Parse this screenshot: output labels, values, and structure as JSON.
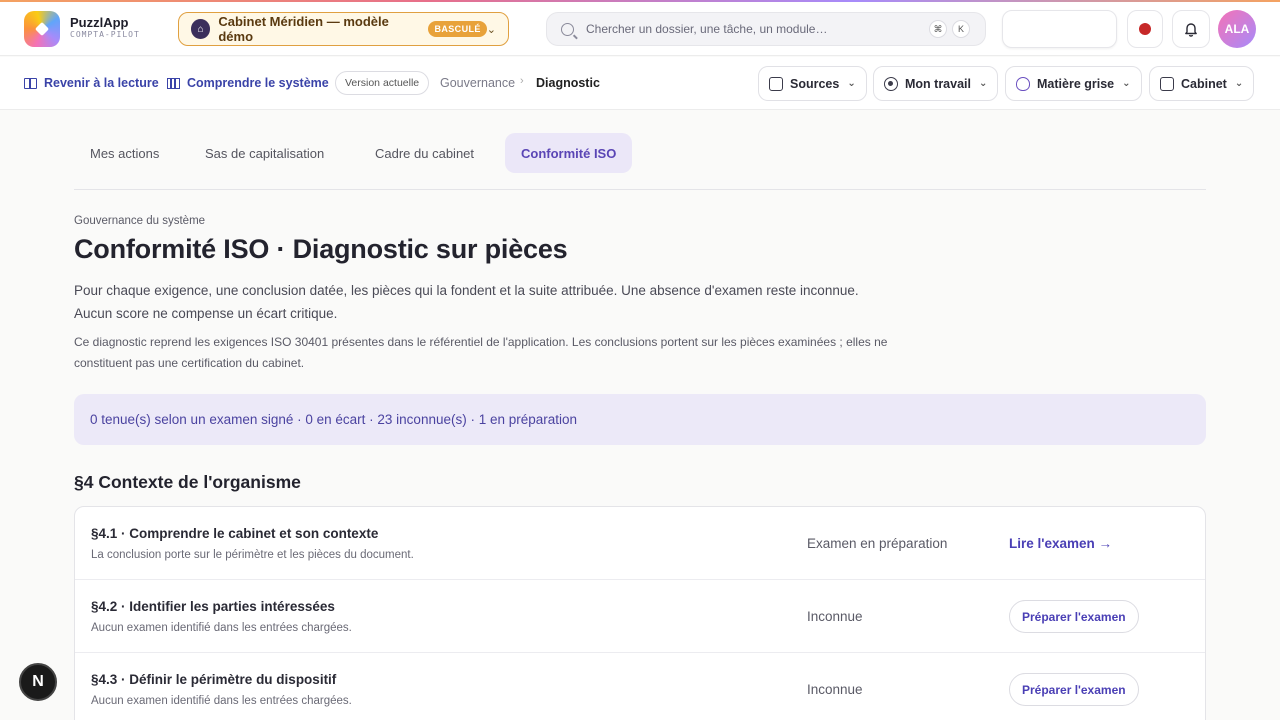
{
  "brand": {
    "name": "PuzzlApp",
    "subtitle": "COMPTA-PILOT"
  },
  "cabinet": {
    "name": "Cabinet Méridien — modèle démo",
    "badge": "BASCULÉ"
  },
  "search": {
    "placeholder": "Chercher un dossier, une tâche, un module…",
    "kbd_modifier": "⌘",
    "kbd_key": "K"
  },
  "user": {
    "initials": "ALA"
  },
  "nav": {
    "back_label": "Revenir à la lecture",
    "understand_label": "Comprendre le système",
    "version_chip": "Version actuelle",
    "breadcrumb": [
      "Gouvernance",
      "Diagnostic"
    ],
    "menus": [
      {
        "label": "Sources",
        "icon": "inbox-icon"
      },
      {
        "label": "Mon travail",
        "icon": "target-icon"
      },
      {
        "label": "Matière grise",
        "icon": "brain-icon"
      },
      {
        "label": "Cabinet",
        "icon": "building-icon"
      }
    ]
  },
  "tabs": [
    {
      "label": "Mes actions",
      "active": false
    },
    {
      "label": "Sas de capitalisation",
      "active": false
    },
    {
      "label": "Cadre du cabinet",
      "active": false
    },
    {
      "label": "Conformité ISO",
      "active": true
    }
  ],
  "page": {
    "eyebrow": "Gouvernance du système",
    "title": "Conformité ISO · Diagnostic sur pièces",
    "lead_line1": "Pour chaque exigence, une conclusion datée, les pièces qui la fondent et la suite attribuée. Une absence d'examen reste inconnue.",
    "lead_line2": "Aucun score ne compense un écart critique.",
    "note": "Ce diagnostic reprend les exigences ISO 30401 présentes dans le référentiel de l'application. Les conclusions portent sur les pièces examinées ; elles ne constituent pas une certification du cabinet.",
    "summary": "0 tenue(s) selon un examen signé · 0 en écart · 23 inconnue(s) · 1 en préparation"
  },
  "section": {
    "title": "§4 Contexte de l'organisme",
    "requirements": [
      {
        "title": "§4.1 · Comprendre le cabinet et son contexte",
        "desc": "La conclusion porte sur le périmètre et les pièces du document.",
        "status": "Examen en préparation",
        "action": "Lire l'examen →",
        "action_type": "link"
      },
      {
        "title": "§4.2 · Identifier les parties intéressées",
        "desc": "Aucun examen identifié dans les entrées chargées.",
        "status": "Inconnue",
        "action": "Préparer l'examen",
        "action_type": "button"
      },
      {
        "title": "§4.3 · Définir le périmètre du dispositif",
        "desc": "Aucun examen identifié dans les entrées chargées.",
        "status": "Inconnue",
        "action": "Préparer l'examen",
        "action_type": "button"
      }
    ]
  },
  "dev_badge": "N",
  "colors": {
    "accent": "#5a45b5",
    "link": "#3a43a8",
    "summary_bg": "#ece9f8",
    "cabinet_border": "#e0a040",
    "record": "#c62828"
  }
}
